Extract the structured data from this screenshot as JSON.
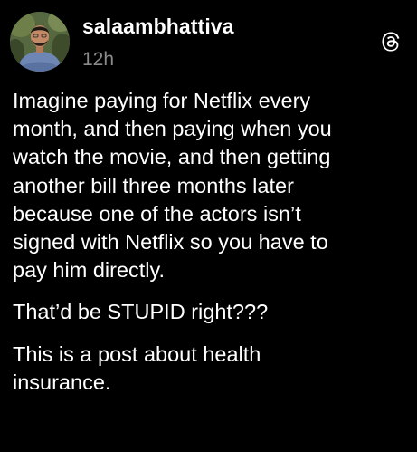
{
  "post": {
    "username": "salaambhattiva",
    "timestamp": "12h",
    "app_icon": "threads-icon",
    "paragraphs": [
      "Imagine paying for Netflix every\nmonth, and then paying when you\nwatch the movie, and then getting\nanother bill three months later\nbecause one of the actors isn’t\nsigned with Netflix so you have to\npay him directly.",
      "That’d be STUPID right???",
      "This is a post about health\ninsurance."
    ]
  },
  "colors": {
    "background": "#000000",
    "text": "#ffffff",
    "muted": "#8a8a8a"
  }
}
